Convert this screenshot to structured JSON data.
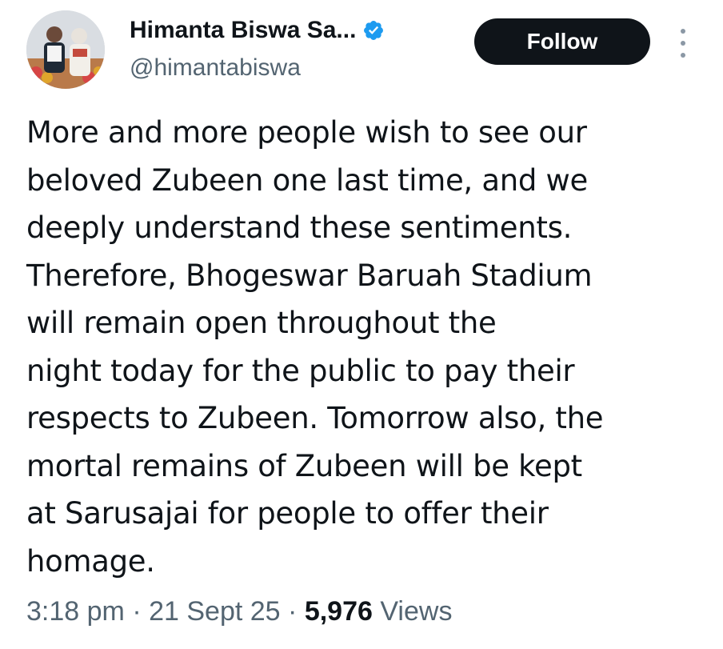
{
  "author": {
    "name": "Himanta Biswa Sa...",
    "handle": "@himantabiswa",
    "verified": true,
    "verified_color": "#1d9bf0"
  },
  "actions": {
    "follow_label": "Follow",
    "more_icon": "more-vertical-icon"
  },
  "tweet": {
    "text": "More and more people wish to see our\nbeloved Zubeen one last time, and we\ndeeply understand these sentiments.\nTherefore, Bhogeswar Baruah Stadium\nwill remain open throughout the\nnight today for the public to pay their\nrespects to Zubeen. Tomorrow also, the\nmortal remains of Zubeen will be kept\nat Sarusajai for people to offer their\nhomage."
  },
  "meta": {
    "time": "3:18 pm",
    "separator": "·",
    "date": "21 Sept 25",
    "views_count": "5,976",
    "views_label": "Views"
  },
  "colors": {
    "text_primary": "#0f1419",
    "text_secondary": "#536471",
    "button_bg": "#0f1419",
    "button_text": "#ffffff"
  }
}
